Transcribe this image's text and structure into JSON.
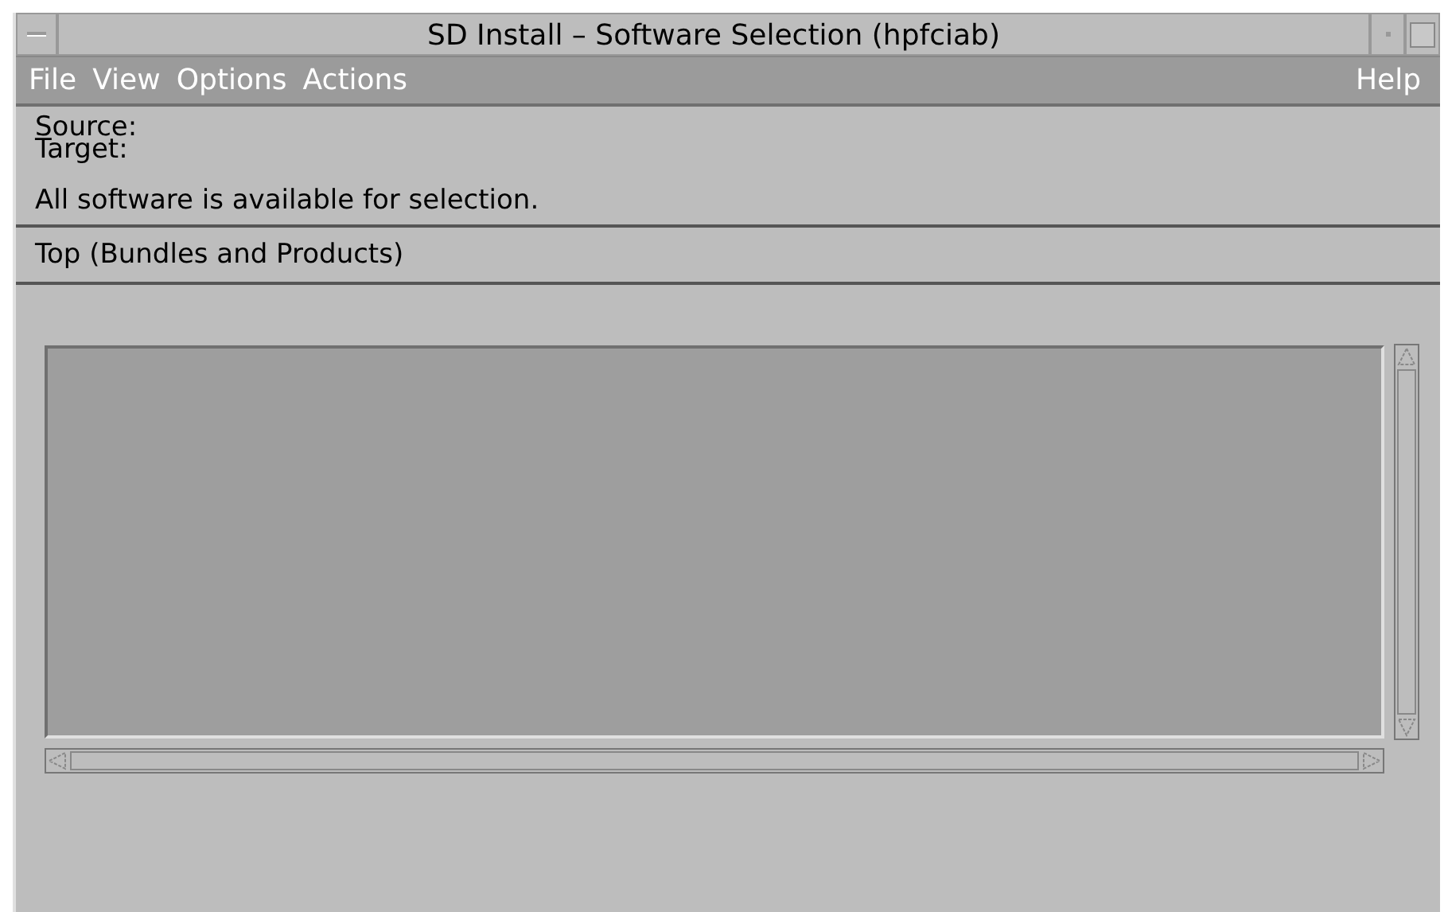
{
  "window": {
    "title": "SD Install – Software Selection (hpfciab)"
  },
  "menu_bar": {
    "left": [
      {
        "label": "File"
      },
      {
        "label": "View"
      },
      {
        "label": "Options"
      },
      {
        "label": "Actions"
      }
    ],
    "right": [
      {
        "label": "Help"
      }
    ]
  },
  "info": {
    "source_label": "Source:",
    "target_label": "Target:",
    "message": "All software is available for selection."
  },
  "level_header": "Top (Bundles and Products)"
}
